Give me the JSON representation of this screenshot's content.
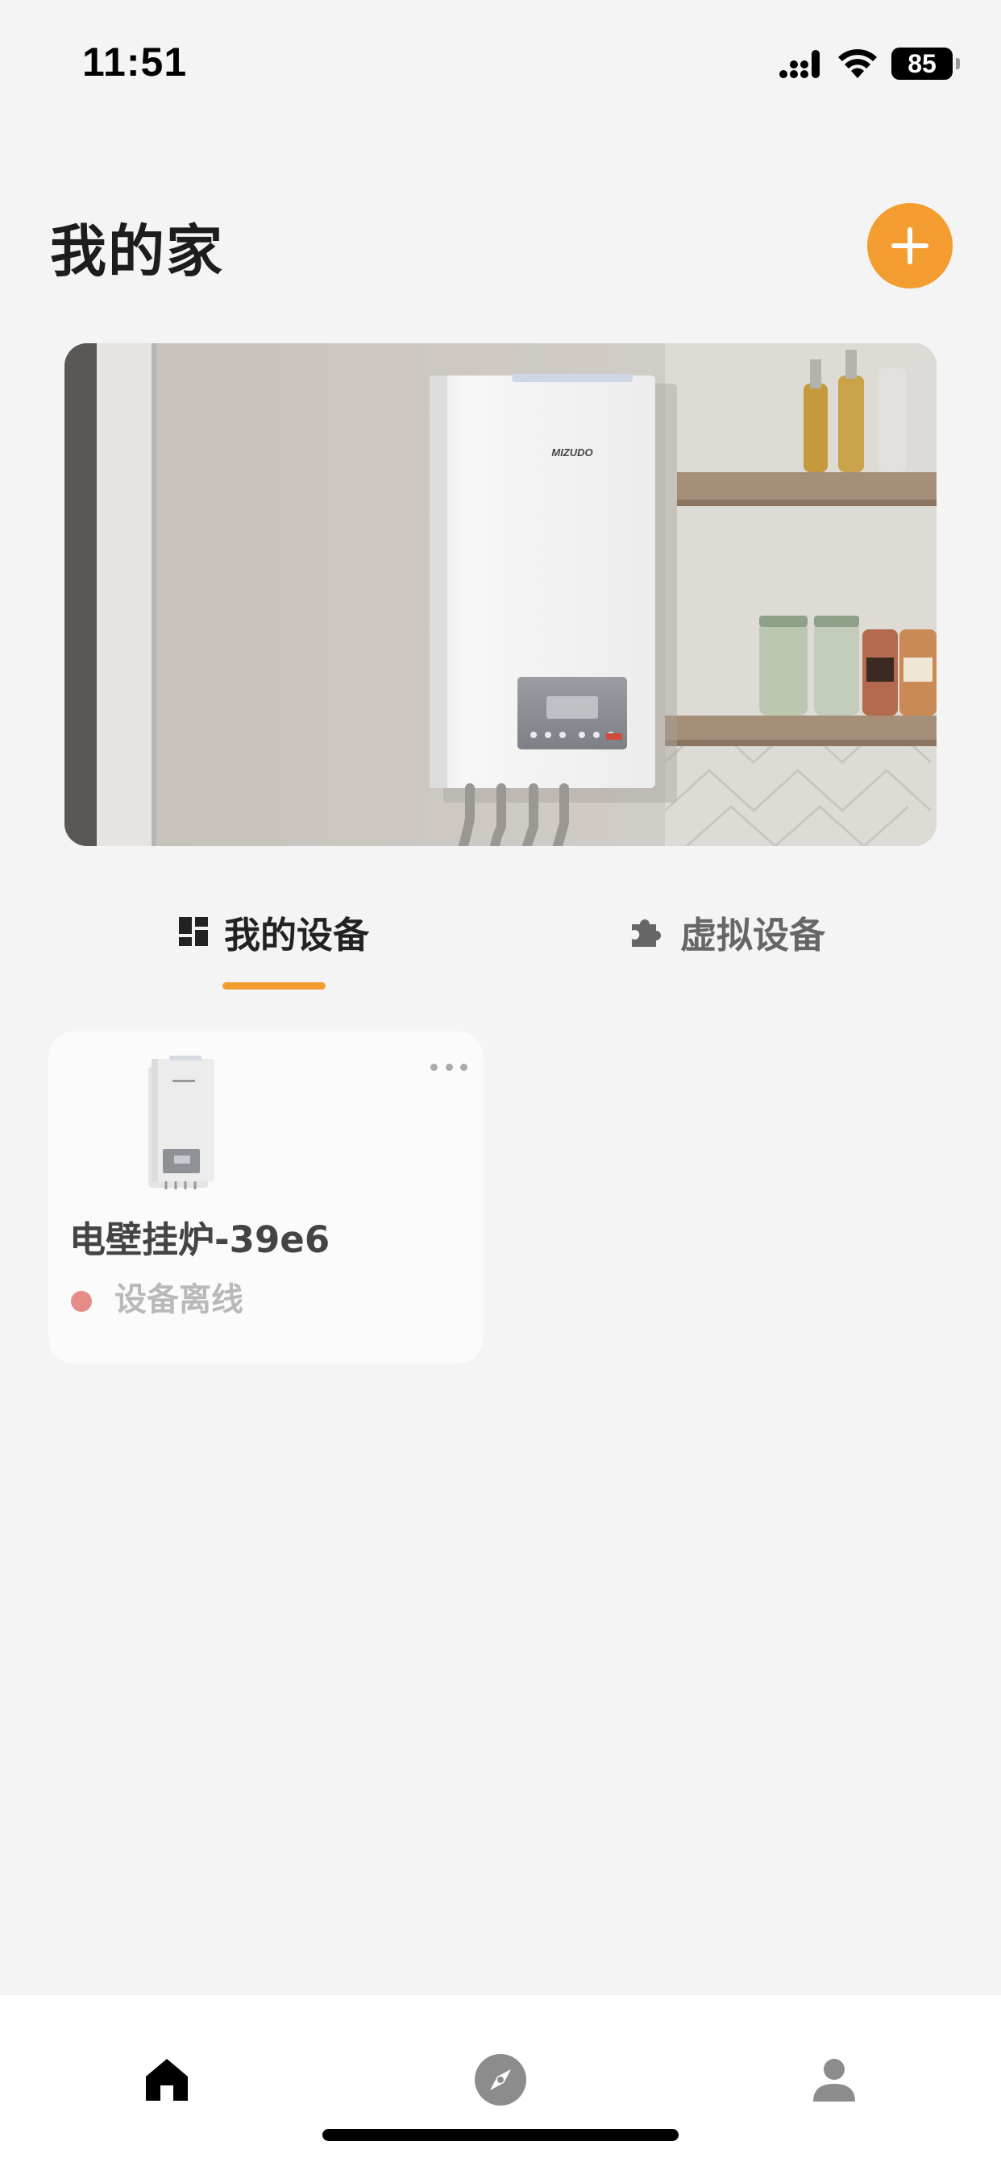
{
  "status_bar": {
    "time": "11:51",
    "battery": "85"
  },
  "header": {
    "title": "我的家"
  },
  "banner": {
    "brand": "MIZUDO"
  },
  "tabs": [
    {
      "label": "我的设备",
      "icon": "dashboard-icon",
      "active": true
    },
    {
      "label": "虚拟设备",
      "icon": "puzzle-icon",
      "active": false
    }
  ],
  "devices": [
    {
      "name": "电壁挂炉-39e6",
      "status": "设备离线",
      "status_color": "#e58c88"
    }
  ],
  "nav": [
    {
      "icon": "home-icon",
      "active": true
    },
    {
      "icon": "compass-icon",
      "active": false
    },
    {
      "icon": "profile-icon",
      "active": false
    }
  ],
  "colors": {
    "accent": "#f39c2f",
    "background": "#f4f4f4"
  }
}
